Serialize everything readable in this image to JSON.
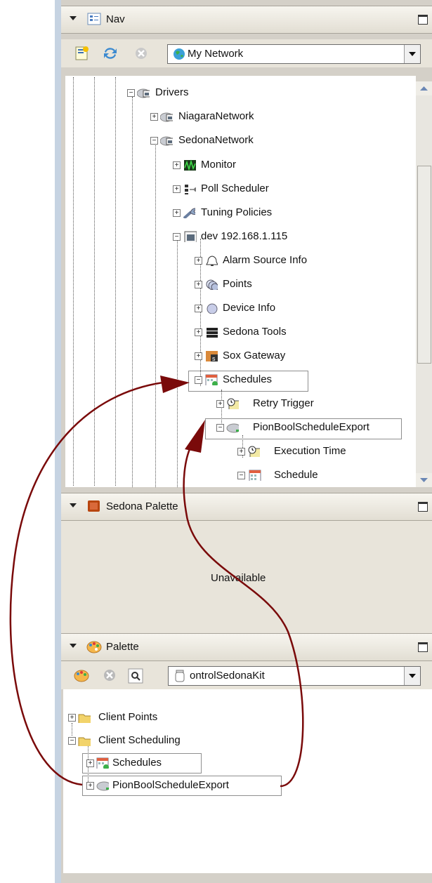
{
  "nav": {
    "title": "Nav",
    "network_select": "My Network",
    "tree": [
      {
        "label": "Drivers",
        "expanded": true
      },
      {
        "label": "NiagaraNetwork",
        "expanded": false
      },
      {
        "label": "SedonaNetwork",
        "expanded": true
      },
      {
        "label": "Monitor",
        "expanded": false
      },
      {
        "label": "Poll Scheduler",
        "expanded": false
      },
      {
        "label": "Tuning Policies",
        "expanded": false
      },
      {
        "label": "dev 192.168.1.115",
        "expanded": true
      },
      {
        "label": "Alarm Source Info",
        "expanded": false
      },
      {
        "label": "Points",
        "expanded": false
      },
      {
        "label": "Device Info",
        "expanded": false
      },
      {
        "label": "Sedona Tools",
        "expanded": false
      },
      {
        "label": "Sox Gateway",
        "expanded": false
      },
      {
        "label": "Schedules",
        "expanded": true
      },
      {
        "label": "Retry Trigger",
        "expanded": false
      },
      {
        "label": "PionBoolScheduleExport",
        "expanded": true
      },
      {
        "label": "Execution Time",
        "expanded": false
      },
      {
        "label": "Schedule",
        "expanded": true
      }
    ]
  },
  "sedona_palette": {
    "title": "Sedona Palette",
    "message": "Unavailable"
  },
  "palette": {
    "title": "Palette",
    "kit_select": "ontrolSedonaKit",
    "tree": [
      {
        "label": "Client Points",
        "expanded": false
      },
      {
        "label": "Client Scheduling",
        "expanded": true
      },
      {
        "label": "Schedules",
        "expanded": false
      },
      {
        "label": "PionBoolScheduleExport",
        "expanded": false
      }
    ]
  },
  "colors": {
    "annotation_arrow": "#7a0a0a",
    "accent_blue": "#2f6fb8"
  }
}
